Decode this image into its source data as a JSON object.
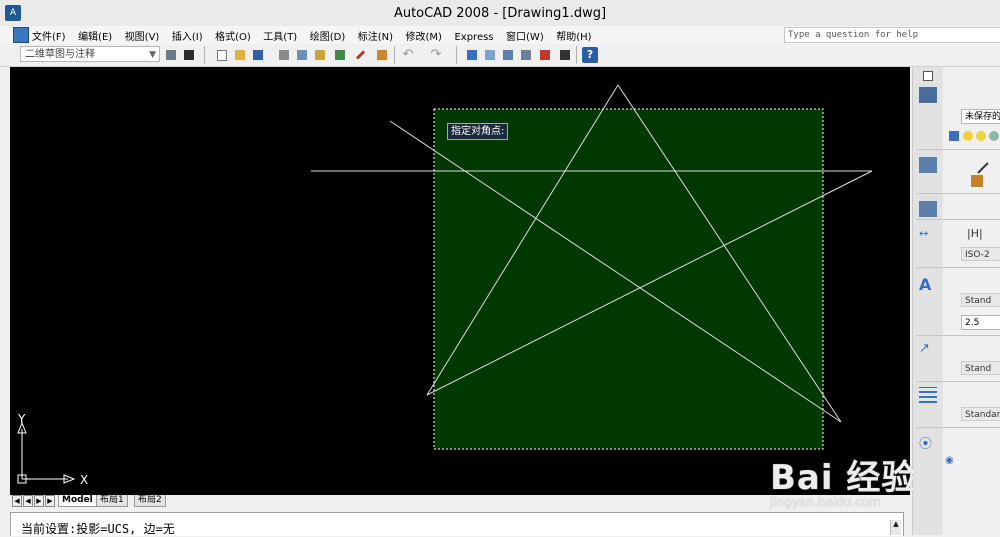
{
  "window": {
    "title": "AutoCAD 2008 - [Drawing1.dwg]"
  },
  "menu": {
    "items": [
      "文件(F)",
      "编辑(E)",
      "视图(V)",
      "插入(I)",
      "格式(O)",
      "工具(T)",
      "绘图(D)",
      "标注(N)",
      "修改(M)",
      "Express",
      "窗口(W)",
      "帮助(H)"
    ]
  },
  "help": {
    "placeholder": "Type a question for help"
  },
  "toolbar": {
    "workspace": "二维草图与注释"
  },
  "canvas": {
    "background": "#000000",
    "selection_fill": "#003800",
    "prompt": "指定对角点:",
    "ucs_x": "X",
    "ucs_y": "Y"
  },
  "tabs": {
    "items": [
      "Model",
      "布局1",
      "布局2"
    ],
    "active": "Model"
  },
  "command": {
    "text": "当前设置:投影=UCS, 边=无"
  },
  "dashboard": {
    "layer_state": "未保存的",
    "dim_style": "ISO-2",
    "text_style": "Stand",
    "text_height": "2.5",
    "multileader_style": "Stand",
    "table_style": "Standar"
  },
  "watermark": {
    "brand": "Bai 经验",
    "url": "jingyan.baidu.com"
  }
}
